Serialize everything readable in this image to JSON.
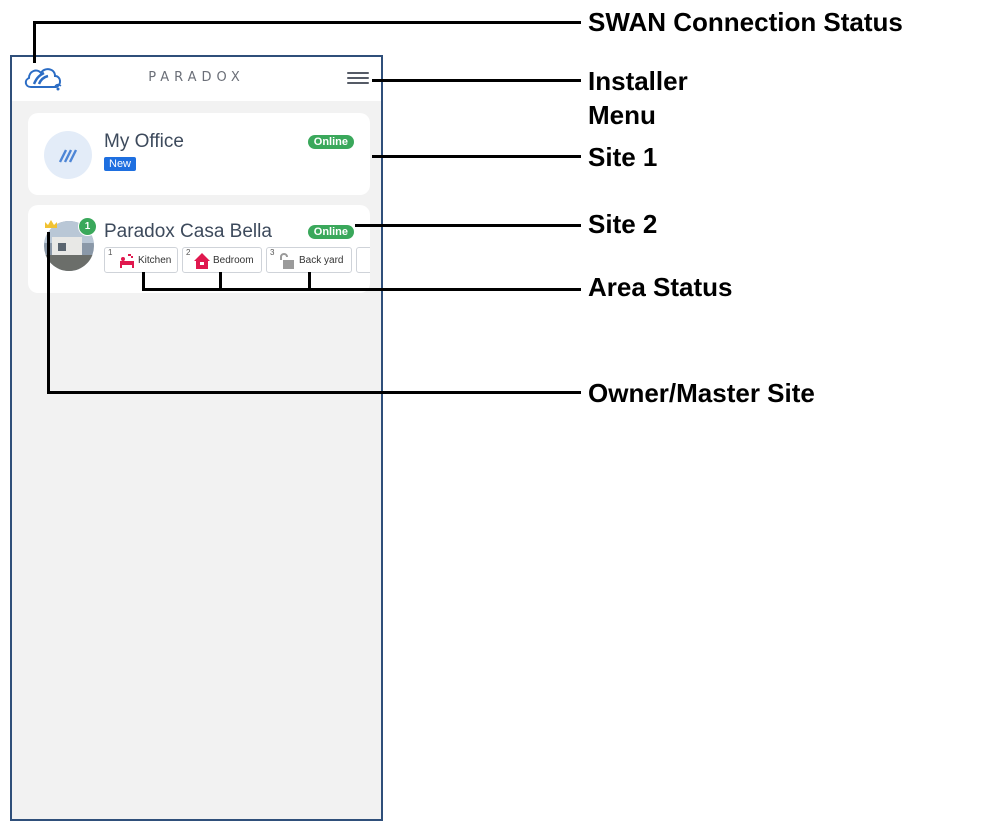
{
  "app": {
    "brand": "PARADOX"
  },
  "sites": [
    {
      "name": "My Office",
      "status": "Online",
      "tag": "New"
    },
    {
      "name": "Paradox Casa Bella",
      "status": "Online",
      "badge_count": "1",
      "areas": [
        {
          "number": "1",
          "label": "Kitchen",
          "icon": "armed-sleep-icon"
        },
        {
          "number": "2",
          "label": "Bedroom",
          "icon": "armed-home-icon"
        },
        {
          "number": "3",
          "label": "Back yard",
          "icon": "disarmed-lock-icon"
        }
      ]
    }
  ],
  "callouts": {
    "swan": "SWAN Connection Status",
    "installer_line1": "Installer",
    "installer_line2": "Menu",
    "site1": "Site 1",
    "site2": "Site 2",
    "area_status": "Area Status",
    "owner": "Owner/Master Site"
  },
  "colors": {
    "online": "#3aa85b",
    "new": "#1e6fe0",
    "alarm_red": "#e0184e",
    "frame": "#2f4f7a"
  }
}
